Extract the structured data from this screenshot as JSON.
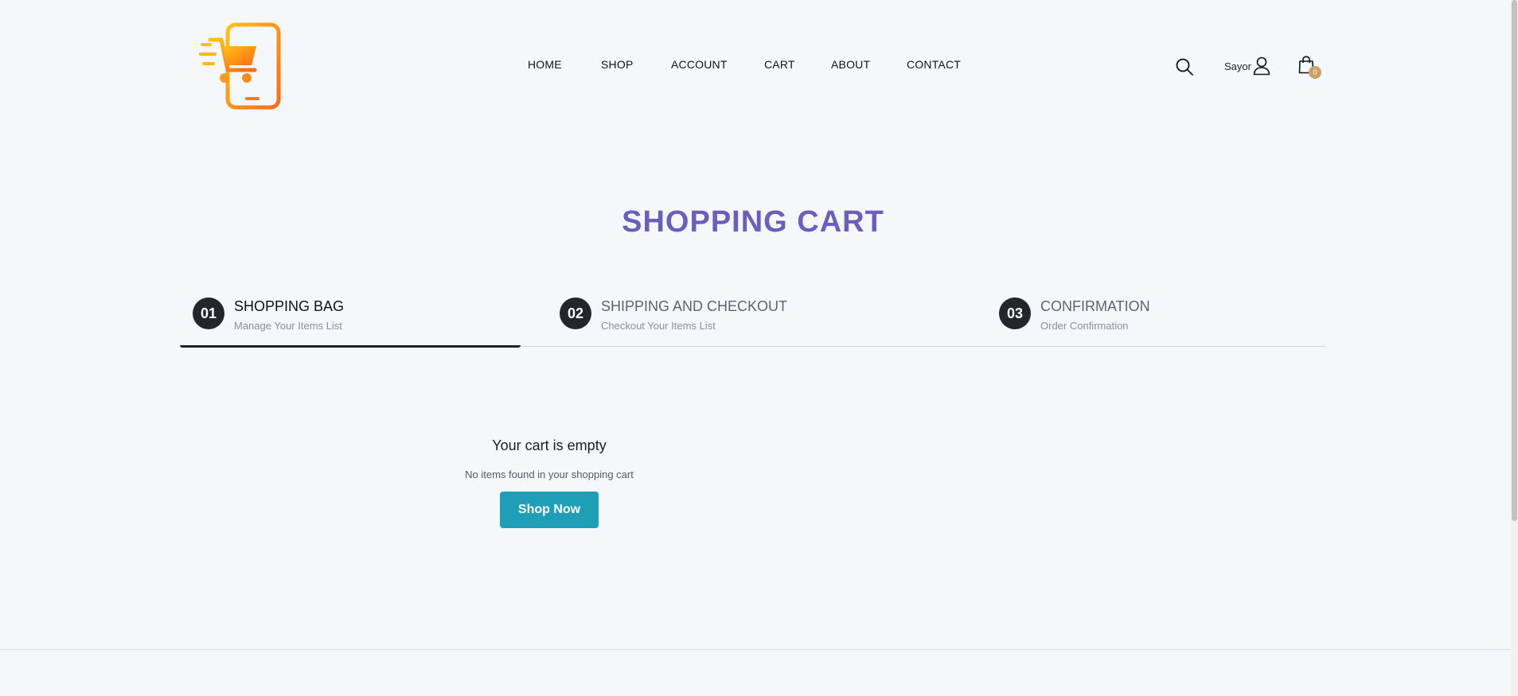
{
  "header": {
    "nav": [
      {
        "label": "HOME"
      },
      {
        "label": "SHOP"
      },
      {
        "label": "ACCOUNT"
      },
      {
        "label": "CART"
      },
      {
        "label": "ABOUT"
      },
      {
        "label": "CONTACT"
      }
    ],
    "account_name": "Sayor",
    "cart_count": "0",
    "icons": {
      "logo": "mobile-cart-logo",
      "search": "search-icon",
      "account": "user-icon",
      "cart": "shopping-bag-icon"
    }
  },
  "main": {
    "title": "SHOPPING CART",
    "steps": [
      {
        "number": "01",
        "title": "SHOPPING BAG",
        "subtitle": "Manage Your Items List"
      },
      {
        "number": "02",
        "title": "SHIPPING AND CHECKOUT",
        "subtitle": "Checkout Your Items List"
      },
      {
        "number": "03",
        "title": "CONFIRMATION",
        "subtitle": "Order Confirmation"
      }
    ],
    "empty_cart": {
      "title": "Your cart is empty",
      "message": "No items found in your shopping cart",
      "button_label": "Shop Now"
    }
  },
  "colors": {
    "title": "#6a5fbf",
    "button": "#1e9fb7",
    "badge": "#c8a165",
    "step_circle": "#23262b",
    "background": "#f5f8fa"
  }
}
